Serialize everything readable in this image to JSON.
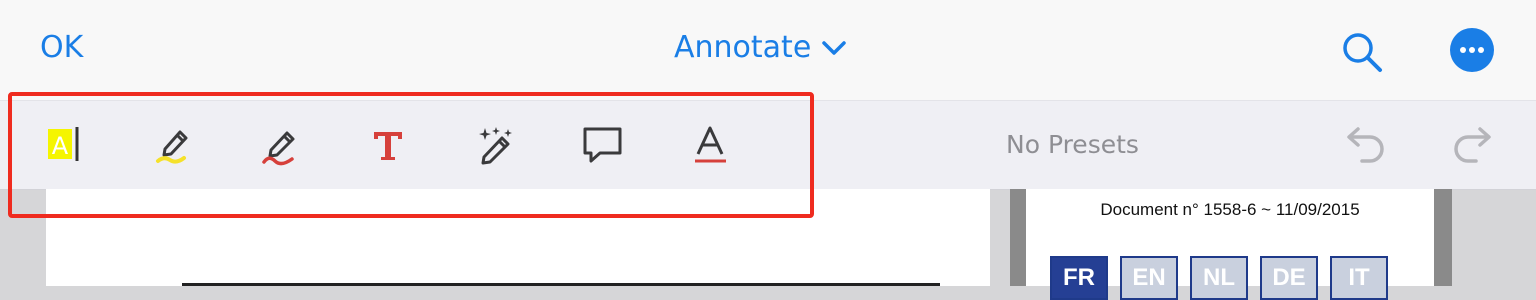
{
  "header": {
    "ok_label": "OK",
    "mode_label": "Annotate",
    "accent_color": "#1a7ee6"
  },
  "toolbar": {
    "tools": [
      {
        "name": "text-highlight-tool",
        "icon": "highlight-text-icon",
        "color": "#f5f500"
      },
      {
        "name": "highlighter-tool",
        "icon": "highlighter-pen-icon",
        "color": "#f5e12a"
      },
      {
        "name": "pen-tool",
        "icon": "pen-icon",
        "color": "#d6403b"
      },
      {
        "name": "text-tool",
        "icon": "text-T-icon",
        "color": "#d6403b"
      },
      {
        "name": "magic-pen-tool",
        "icon": "magic-pen-icon",
        "color": "#3a3a3c"
      },
      {
        "name": "note-tool",
        "icon": "speech-bubble-icon",
        "color": "#3a3a3c"
      },
      {
        "name": "text-color-tool",
        "icon": "text-color-A-icon",
        "color": "#d6403b"
      }
    ],
    "presets_label": "No Presets"
  },
  "document": {
    "doc_number": "Document n° 1558-6 ~ 11/09/2015",
    "languages": [
      "FR",
      "EN",
      "NL",
      "DE",
      "IT"
    ],
    "active_language": "FR"
  },
  "annotation_highlight_color": "#ef2b1f"
}
